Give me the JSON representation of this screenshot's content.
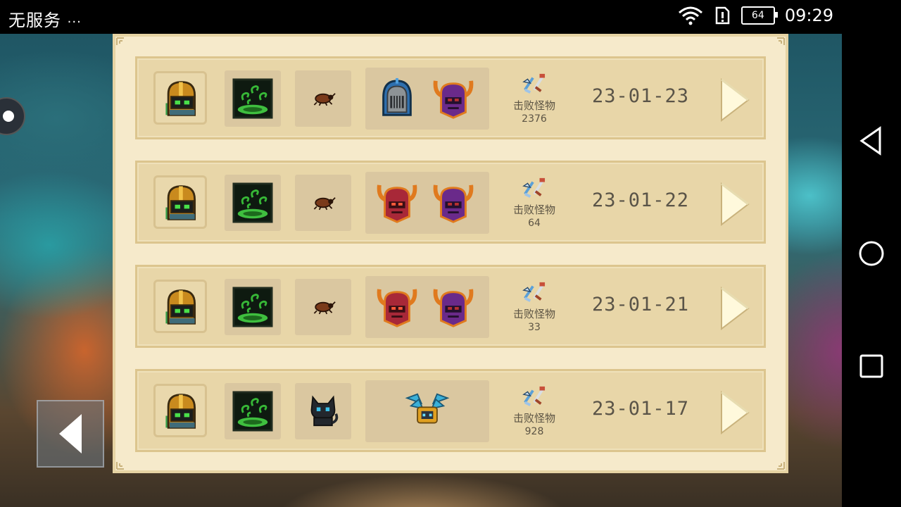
{
  "status_bar": {
    "carrier": "无服务",
    "more_indicator": "···",
    "battery_level": "64",
    "time": "09:29",
    "icons": [
      "wifi-icon",
      "sim-alert-icon",
      "battery-icon"
    ]
  },
  "history": {
    "stat_label": "击败怪物",
    "records": [
      {
        "hero": "knight-helmet-icon",
        "skill": "green-vortex-icon",
        "pet": "beetle-icon",
        "bosses": [
          "iron-knight-boss-icon",
          "purple-demon-boss-icon"
        ],
        "kills": "2376",
        "date": "23-01-23"
      },
      {
        "hero": "knight-helmet-icon",
        "skill": "green-vortex-icon",
        "pet": "beetle-icon",
        "bosses": [
          "red-demon-boss-icon",
          "purple-demon-boss-icon"
        ],
        "kills": "64",
        "date": "23-01-22"
      },
      {
        "hero": "knight-helmet-icon",
        "skill": "green-vortex-icon",
        "pet": "beetle-icon",
        "bosses": [
          "red-demon-boss-icon",
          "purple-demon-boss-icon"
        ],
        "kills": "33",
        "date": "23-01-21"
      },
      {
        "hero": "knight-helmet-icon",
        "skill": "green-vortex-icon",
        "pet": "black-cat-icon",
        "bosses": [
          "winged-crab-boss-icon"
        ],
        "kills": "928",
        "date": "23-01-17"
      }
    ]
  },
  "nav": {
    "icons": [
      "back-triangle-icon",
      "home-circle-icon",
      "recents-square-icon"
    ]
  },
  "colors": {
    "panel": "#f6eacb",
    "row": "#e8d6a8",
    "slot": "#dac7a0",
    "text": "#5a5448"
  }
}
